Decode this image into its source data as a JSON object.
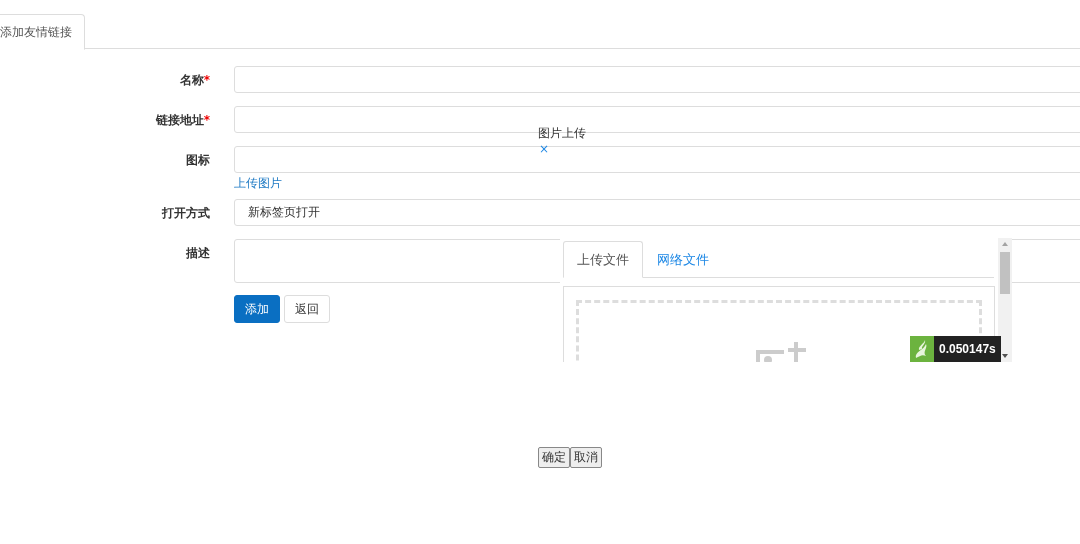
{
  "tabs": [
    {
      "label": "添加友情链接",
      "selected": true
    }
  ],
  "form": {
    "fields": [
      {
        "label": "名称",
        "required_mark": "*",
        "kind": "input"
      },
      {
        "label": "链接地址",
        "required_mark": "*",
        "kind": "input"
      },
      {
        "label": "图标",
        "kind": "input",
        "link": "上传图片"
      },
      {
        "label": "打开方式",
        "kind": "select",
        "value": "新标签页打开"
      },
      {
        "label": "描述",
        "kind": "textarea"
      }
    ],
    "buttons": [
      {
        "label": "添加",
        "primary": true
      },
      {
        "label": "返回",
        "primary": false
      }
    ]
  },
  "dialog": {
    "title": "图片上传",
    "close": "×",
    "tabs": [
      {
        "label": "上传文件",
        "selected": true
      },
      {
        "label": "网络文件",
        "selected": false
      }
    ],
    "timer": "0.050147s",
    "buttons": [
      {
        "label": "确定"
      },
      {
        "label": "取消"
      }
    ]
  }
}
